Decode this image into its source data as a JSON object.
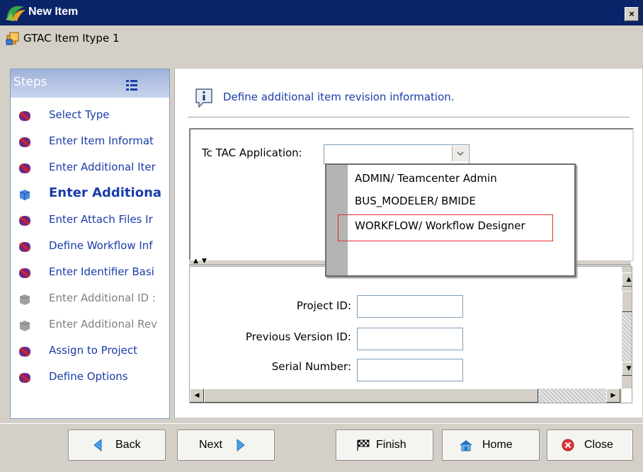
{
  "window": {
    "title": "New Item",
    "close": "×"
  },
  "subtitle": "GTAC Item Itype 1",
  "steps": {
    "header": "Steps",
    "items": [
      {
        "label": "Select Type",
        "state": "done"
      },
      {
        "label": "Enter Item Informat",
        "state": "done"
      },
      {
        "label": "Enter Additional Iter",
        "state": "done"
      },
      {
        "label": "Enter Additiona",
        "state": "current"
      },
      {
        "label": "Enter Attach Files Ir",
        "state": "done"
      },
      {
        "label": "Define Workflow Inf",
        "state": "done"
      },
      {
        "label": "Enter Identifier Basi",
        "state": "done"
      },
      {
        "label": "Enter Additional ID :",
        "state": "disabled"
      },
      {
        "label": "Enter Additional Rev",
        "state": "disabled"
      },
      {
        "label": "Assign to Project",
        "state": "done"
      },
      {
        "label": "Define Options",
        "state": "done"
      }
    ]
  },
  "main": {
    "info": "Define additional item revision information.",
    "app_label": "Tc TAC Application:",
    "app_value": "",
    "dropdown_options": [
      "ADMIN/ Teamcenter Admin",
      "BUS_MODELER/ BMIDE",
      "WORKFLOW/ Workflow Designer"
    ],
    "highlighted_option": "WORKFLOW/ Workflow Designer",
    "fields": [
      {
        "label": "Project ID:",
        "value": ""
      },
      {
        "label": "Previous Version ID:",
        "value": ""
      },
      {
        "label": "Serial Number:",
        "value": ""
      }
    ]
  },
  "footer": {
    "back": "Back",
    "next": "Next",
    "finish": "Finish",
    "home": "Home",
    "close": "Close"
  },
  "colors": {
    "titlebar": "#0a246a",
    "link": "#1a3ca8",
    "highlight_border": "#e03030"
  }
}
